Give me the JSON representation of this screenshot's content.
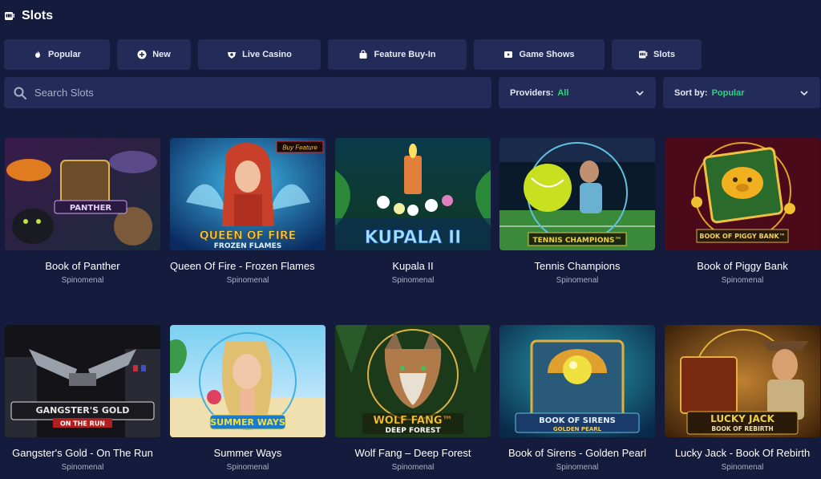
{
  "header": {
    "title": "Slots",
    "icon": "slot-machine-icon"
  },
  "tabs": [
    {
      "label": "Popular",
      "icon": "fire-icon"
    },
    {
      "label": "New",
      "icon": "plus-circle-icon"
    },
    {
      "label": "Live Casino",
      "icon": "casino-chip-icon"
    },
    {
      "label": "Feature Buy-In",
      "icon": "shopping-bag-icon"
    },
    {
      "label": "Game Shows",
      "icon": "play-icon"
    },
    {
      "label": "Slots",
      "icon": "slot-machine-icon"
    }
  ],
  "search": {
    "placeholder": "Search Slots",
    "value": ""
  },
  "filters": {
    "providers": {
      "label": "Providers:",
      "value": "All"
    },
    "sort": {
      "label": "Sort by:",
      "value": "Popular"
    }
  },
  "colors": {
    "background": "#151b3c",
    "panel": "#232c58",
    "accent": "#2fd37f"
  },
  "games": [
    {
      "title": "Book of Panther",
      "provider": "Spinomenal",
      "logo": "PANTHER"
    },
    {
      "title": "Queen Of Fire - Frozen Flames",
      "provider": "Spinomenal",
      "logo_line1": "QUEEN OF FIRE",
      "logo_line2": "FROZEN FLAMES",
      "badge": "Buy Feature"
    },
    {
      "title": "Kupala II",
      "provider": "Spinomenal",
      "logo": "KUPALA II"
    },
    {
      "title": "Tennis Champions",
      "provider": "Spinomenal",
      "logo": "TENNIS CHAMPIONS™"
    },
    {
      "title": "Book of Piggy Bank",
      "provider": "Spinomenal",
      "logo": "BOOK OF PIGGY BANK™"
    },
    {
      "title": "Gangster's Gold - On The Run",
      "provider": "Spinomenal",
      "logo_line1": "GANGSTER'S GOLD",
      "logo_line2": "ON THE RUN"
    },
    {
      "title": "Summer Ways",
      "provider": "Spinomenal",
      "logo": "SUMMER WAYS"
    },
    {
      "title": "Wolf Fang – Deep Forest",
      "provider": "Spinomenal",
      "logo_line1": "WOLF FANG™",
      "logo_line2": "DEEP FOREST"
    },
    {
      "title": "Book of Sirens - Golden Pearl",
      "provider": "Spinomenal",
      "logo_line1": "BOOK OF SIRENS",
      "logo_line2": "GOLDEN PEARL"
    },
    {
      "title": "Lucky Jack - Book Of Rebirth",
      "provider": "Spinomenal",
      "logo_line1": "LUCKY JACK",
      "logo_line2": "BOOK OF REBIRTH"
    }
  ]
}
